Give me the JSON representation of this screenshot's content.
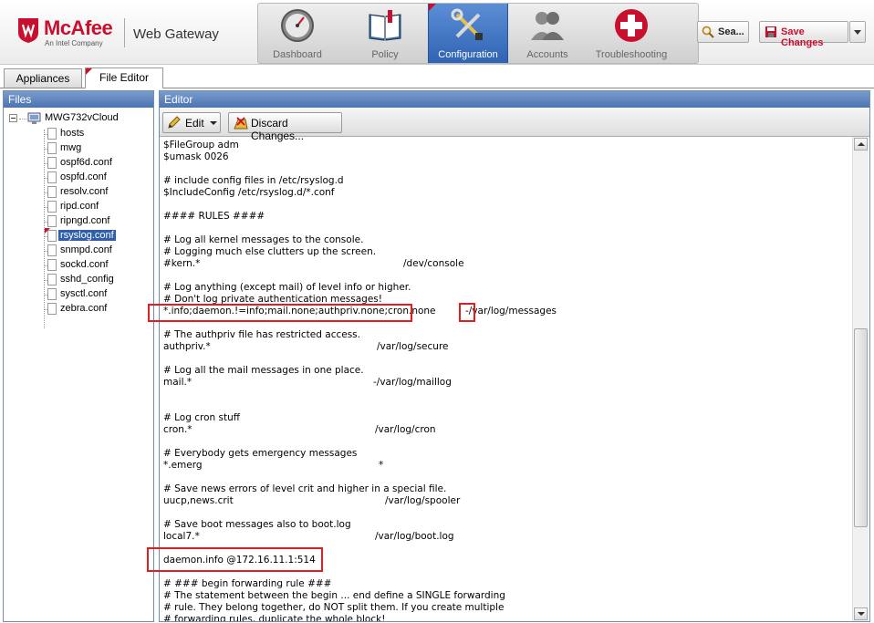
{
  "brand": {
    "name": "McAfee",
    "tagline": "An Intel Company",
    "product": "Web Gateway",
    "color": "#c8102e"
  },
  "nav": {
    "items": [
      {
        "label": "Dashboard",
        "icon": "gauge-icon"
      },
      {
        "label": "Policy",
        "icon": "book-icon"
      },
      {
        "label": "Configuration",
        "icon": "tools-icon",
        "active": true
      },
      {
        "label": "Accounts",
        "icon": "users-icon"
      },
      {
        "label": "Troubleshooting",
        "icon": "medical-cross-icon"
      }
    ],
    "accent": "#2f63b3"
  },
  "toolbar_top": {
    "search_label": "Sea...",
    "save_label": "Save Changes"
  },
  "tabs": [
    {
      "label": "Appliances"
    },
    {
      "label": "File Editor",
      "active": true
    }
  ],
  "files": {
    "title": "Files",
    "root": "MWG732vCloud",
    "items": [
      "hosts",
      "mwg",
      "ospf6d.conf",
      "ospfd.conf",
      "resolv.conf",
      "ripd.conf",
      "ripngd.conf",
      "rsyslog.conf",
      "snmpd.conf",
      "sockd.conf",
      "sshd_config",
      "sysctl.conf",
      "zebra.conf"
    ],
    "selected": "rsyslog.conf"
  },
  "editor": {
    "title": "Editor",
    "edit_label": "Edit",
    "discard_label": "Discard Changes...",
    "lines": [
      {
        "a": "$FileGroup adm"
      },
      {
        "a": "$umask 0026"
      },
      {
        "a": ""
      },
      {
        "a": "# include config files in /etc/rsyslog.d"
      },
      {
        "a": "$IncludeConfig /etc/rsyslog.d/*.conf"
      },
      {
        "a": ""
      },
      {
        "a": "#### RULES ####"
      },
      {
        "a": ""
      },
      {
        "a": "# Log all kernel messages to the console."
      },
      {
        "a": "# Logging much else clutters up the screen."
      },
      {
        "a": "#kern.*",
        "b": "/dev/console"
      },
      {
        "a": ""
      },
      {
        "a": "# Log anything (except mail) of level info or higher."
      },
      {
        "a": "# Don't log private authentication messages!"
      },
      {
        "a": "*.info;daemon.!=info;mail.none;authpriv.none;cron.none",
        "b": "-/var/log/messages"
      },
      {
        "a": ""
      },
      {
        "a": "# The authpriv file has restricted access."
      },
      {
        "a": "authpriv.*",
        "b": "/var/log/secure"
      },
      {
        "a": ""
      },
      {
        "a": "# Log all the mail messages in one place."
      },
      {
        "a": "mail.*",
        "b": "-/var/log/maillog"
      },
      {
        "a": ""
      },
      {
        "a": ""
      },
      {
        "a": "# Log cron stuff"
      },
      {
        "a": "cron.*",
        "b": "/var/log/cron"
      },
      {
        "a": ""
      },
      {
        "a": "# Everybody gets emergency messages"
      },
      {
        "a": "*.emerg",
        "b": "*"
      },
      {
        "a": ""
      },
      {
        "a": "# Save news errors of level crit and higher in a special file."
      },
      {
        "a": "uucp,news.crit",
        "b": "/var/log/spooler"
      },
      {
        "a": ""
      },
      {
        "a": "# Save boot messages also to boot.log"
      },
      {
        "a": "local7.*",
        "b": "/var/log/boot.log"
      },
      {
        "a": ""
      },
      {
        "a": "daemon.info @172.16.11.1:514"
      },
      {
        "a": ""
      },
      {
        "a": "# ### begin forwarding rule ###"
      },
      {
        "a": "# The statement between the begin ... end define a SINGLE forwarding"
      },
      {
        "a": "# rule. They belong together, do NOT split them. If you create multiple"
      },
      {
        "a": "# forwarding rules, duplicate the whole block!"
      }
    ]
  }
}
